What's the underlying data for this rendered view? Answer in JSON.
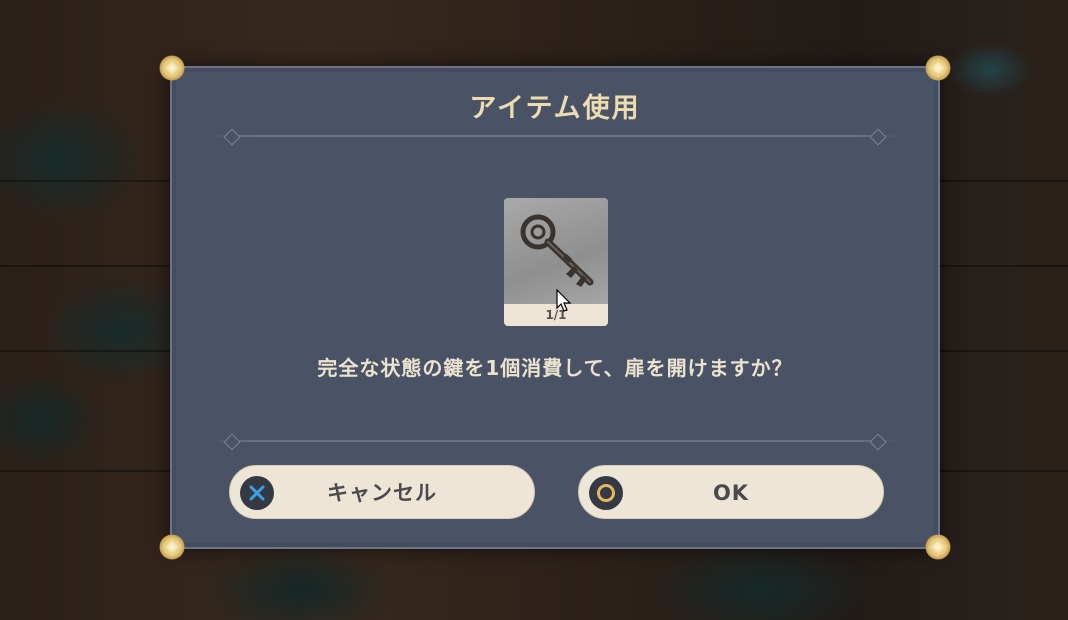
{
  "dialog": {
    "title": "アイテム使用",
    "item": {
      "icon": "key-icon",
      "count": "1/1"
    },
    "message": "完全な状態の鍵を1個消費して、扉を開けますか？",
    "buttons": {
      "cancel": {
        "label": "キャンセル",
        "icon": "cross-icon",
        "icon_color": "#3aa0e8"
      },
      "ok": {
        "label": "OK",
        "icon": "circle-icon",
        "icon_color": "#e5b85a"
      }
    }
  },
  "colors": {
    "panel": "#4a5366",
    "title_text": "#ecdcb0",
    "button_bg": "#ede5d6"
  }
}
